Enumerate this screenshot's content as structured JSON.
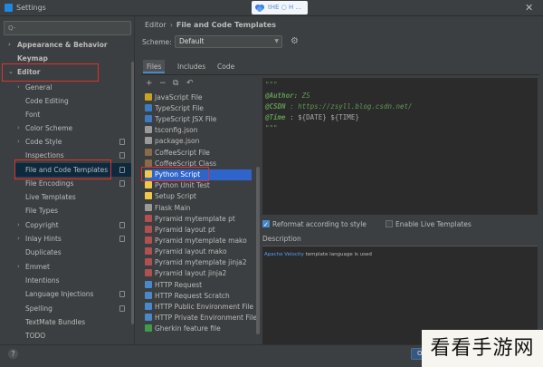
{
  "window": {
    "title": "Settings"
  },
  "watermark": {
    "text": "tHE ○ H ..."
  },
  "search": {
    "placeholder": "Q-"
  },
  "sidebar": {
    "items": [
      {
        "label": "Appearance & Behavior"
      },
      {
        "label": "Keymap"
      },
      {
        "label": "Editor"
      },
      {
        "label": "General"
      },
      {
        "label": "Code Editing"
      },
      {
        "label": "Font"
      },
      {
        "label": "Color Scheme"
      },
      {
        "label": "Code Style"
      },
      {
        "label": "Inspections"
      },
      {
        "label": "File and Code Templates"
      },
      {
        "label": "File Encodings"
      },
      {
        "label": "Live Templates"
      },
      {
        "label": "File Types"
      },
      {
        "label": "Copyright"
      },
      {
        "label": "Inlay Hints"
      },
      {
        "label": "Duplicates"
      },
      {
        "label": "Emmet"
      },
      {
        "label": "Intentions"
      },
      {
        "label": "Language Injections"
      },
      {
        "label": "Spelling"
      },
      {
        "label": "TextMate Bundles"
      },
      {
        "label": "TODO"
      }
    ]
  },
  "breadcrumb": {
    "parent": "Editor",
    "separator": "›",
    "current": "File and Code Templates"
  },
  "scheme": {
    "label": "Scheme:",
    "value": "Default"
  },
  "tabs": [
    {
      "label": "Files"
    },
    {
      "label": "Includes"
    },
    {
      "label": "Code"
    }
  ],
  "toolbar": {
    "add": "+",
    "remove": "−",
    "copy": "⧉",
    "reset": "↶"
  },
  "templates": [
    {
      "label": "JavaScript File"
    },
    {
      "label": "TypeScript File"
    },
    {
      "label": "TypeScript JSX File"
    },
    {
      "label": "tsconfig.json"
    },
    {
      "label": "package.json"
    },
    {
      "label": "CoffeeScript File"
    },
    {
      "label": "CoffeeScript Class"
    },
    {
      "label": "Python Script"
    },
    {
      "label": "Python Unit Test"
    },
    {
      "label": "Setup Script"
    },
    {
      "label": "Flask Main"
    },
    {
      "label": "Pyramid mytemplate pt"
    },
    {
      "label": "Pyramid layout pt"
    },
    {
      "label": "Pyramid mytemplate mako"
    },
    {
      "label": "Pyramid layout mako"
    },
    {
      "label": "Pyramid mytemplate jinja2"
    },
    {
      "label": "Pyramid layout jinja2"
    },
    {
      "label": "HTTP Request"
    },
    {
      "label": "HTTP Request Scratch"
    },
    {
      "label": "HTTP Public Environment File"
    },
    {
      "label": "HTTP Private Environment File"
    },
    {
      "label": "Gherkin feature file"
    }
  ],
  "editor": {
    "line1": "\"\"\"",
    "line2_tag": "@Author:",
    "line2_val": " ZS",
    "line3_tag": "@CSDN",
    "line3_val": "  : https://zsyll.blog.csdn.net/",
    "line4_tag": "@Time",
    "line4_val": "  : ${DATE} ${TIME}",
    "line5": "\"\"\""
  },
  "options": {
    "reformat": "Reformat according to style",
    "live_templates": "Enable Live Templates"
  },
  "description": {
    "label": "Description",
    "link": "Apache Velocity",
    "text": " template language is used"
  },
  "footer": {
    "help": "?",
    "ok": "OK",
    "brand": "看看手游网"
  },
  "close": "✕",
  "colors": {
    "selection": "#2f65ca",
    "highlight_box": "#e03030",
    "accent": "#4a88c7"
  }
}
